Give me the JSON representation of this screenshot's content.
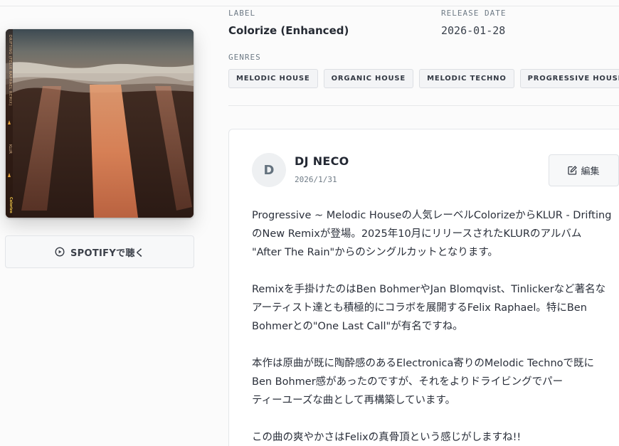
{
  "release": {
    "label_key": "LABEL",
    "label_value": "Colorize (Enhanced)",
    "date_key": "RELEASE DATE",
    "date_value": "2026-01-28",
    "genres_key": "GENRES",
    "genres": [
      "MELODIC HOUSE",
      "ORGANIC HOUSE",
      "MELODIC TECHNO",
      "PROGRESSIVE HOUSE"
    ]
  },
  "cover": {
    "spine_title": "DRIFTING (FELIX RAPHAEL REMIX)",
    "spine_artist": "KLUR",
    "spine_logo": "Colorize"
  },
  "spotify_button": {
    "label": "SPOTIFYで聴く",
    "icon": "play-circle-icon"
  },
  "review": {
    "avatar_letter": "D",
    "author": "DJ NECO",
    "date": "2026/1/31",
    "edit_label": "編集",
    "edit_icon": "edit-icon",
    "paragraphs": [
      [
        " Progressive ~ Melodic Houseの人気レーベルColorizeからKLUR - Drifting",
        "のNew Remixが登場。2025年10月にリリースされたKLURのアルバム",
        "\"After The Rain\"からのシングルカットとなります。"
      ],
      [
        "Remixを手掛けたのはBen BohmerやJan Blomqvist、Tinlickerなど著名な",
        "アーティスト達とも積極的にコラボを展開するFelix Raphael。特にBen",
        "Bohmerとの\"One Last Call\"が有名ですね。"
      ],
      [
        "本作は原曲が既に陶酔感のあるElectronica寄りのMelodic Technoで既に",
        "Ben Bohmer感があったのですが、それをよりドライビングでパー",
        "ティーユーズな曲として再構築しています。"
      ],
      [
        "この曲の爽やかさはFelixの真骨頂という感じがしますね!!"
      ]
    ]
  },
  "colors": {
    "background": "#fbfbfb",
    "card": "#ffffff",
    "border": "#e5e7ea",
    "text": "#2a2f3a",
    "muted": "#6f7b86"
  }
}
